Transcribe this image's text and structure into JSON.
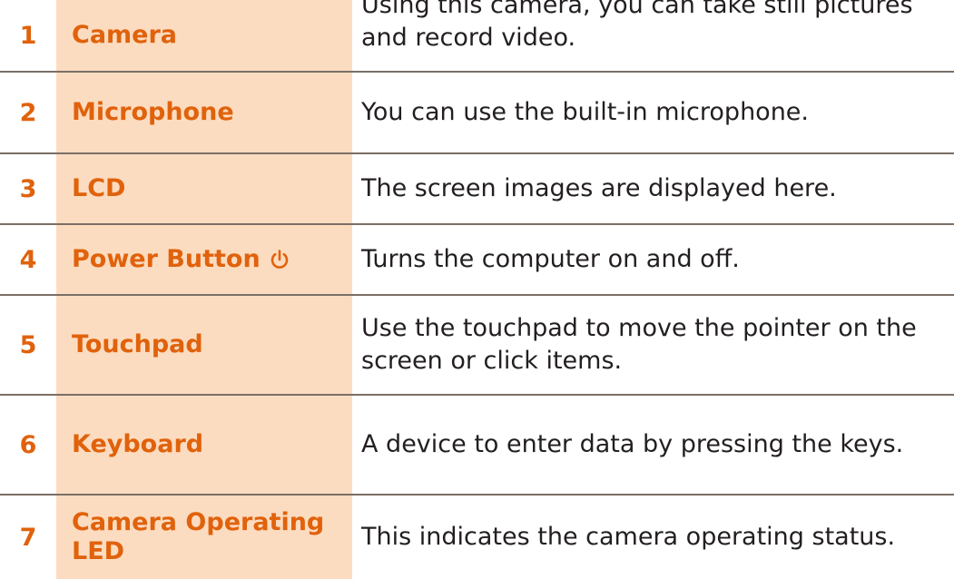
{
  "rows": [
    {
      "number": "1",
      "label": "Camera",
      "description": "Using this camera, you can take still pictures and record video."
    },
    {
      "number": "2",
      "label": "Microphone",
      "description": "You can use the built-in microphone."
    },
    {
      "number": "3",
      "label": "LCD",
      "description": "The screen images are displayed here."
    },
    {
      "number": "4",
      "label": "Power Button",
      "icon": "power-icon",
      "description": "Turns the computer on and off."
    },
    {
      "number": "5",
      "label": "Touchpad",
      "description": "Use the touchpad to move the pointer on the screen or click items."
    },
    {
      "number": "6",
      "label": "Keyboard",
      "description": "A device to enter data by pressing the keys."
    },
    {
      "number": "7",
      "label": "Camera Operating LED",
      "description": "This indicates the camera operating status."
    }
  ],
  "colors": {
    "accent": "#e0620c",
    "label_background": "#fcdcc0",
    "divider": "#7a6f66",
    "text": "#231f20"
  }
}
